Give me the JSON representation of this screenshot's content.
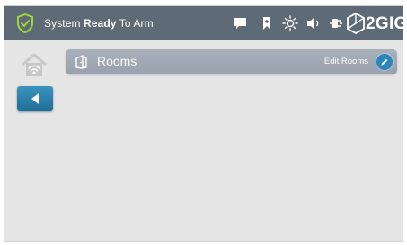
{
  "status_bar": {
    "status_prefix": "System ",
    "status_strong": "Ready",
    "status_suffix": " To Arm",
    "icons": [
      "chat-bubble-icon",
      "bookmark-icon",
      "brightness-icon",
      "volume-icon",
      "power-plug-icon"
    ],
    "brand_text": "2GIG"
  },
  "sidebar": {
    "home_icon": "home-wifi-icon",
    "back_icon": "back-arrow-icon"
  },
  "rooms_bar": {
    "title": "Rooms",
    "edit_label": "Edit Rooms",
    "icon": "rooms-icon",
    "edit_icon": "pencil-icon"
  },
  "colors": {
    "status_bar_bg": "#5e6a76",
    "shield": "#9fd63a",
    "accent_blue": "#2a86bd",
    "rooms_bar_bg": "#a2aab5",
    "page_bg": "#e5e5e6"
  }
}
